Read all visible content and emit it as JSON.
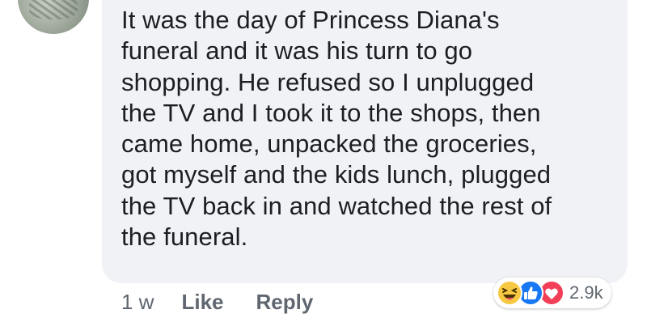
{
  "comment": {
    "lines": [
      "It was the day of Princess Diana's",
      "funeral and it was his turn to go",
      "shopping. He refused so I unplugged",
      "the TV and I took it to the shops, then",
      "came home, unpacked the groceries,",
      "got myself and the kids lunch, plugged",
      "the TV back in and watched the rest of",
      "the funeral."
    ]
  },
  "actions": {
    "time": "1 w",
    "like_label": "Like",
    "reply_label": "Reply"
  },
  "reactions": {
    "icons": [
      "laugh-reaction-icon",
      "like-reaction-icon",
      "love-reaction-icon"
    ],
    "count": "2.9k",
    "colors": {
      "laugh": "#f7c943",
      "like": "#1877f2",
      "love": "#f33e58"
    }
  }
}
